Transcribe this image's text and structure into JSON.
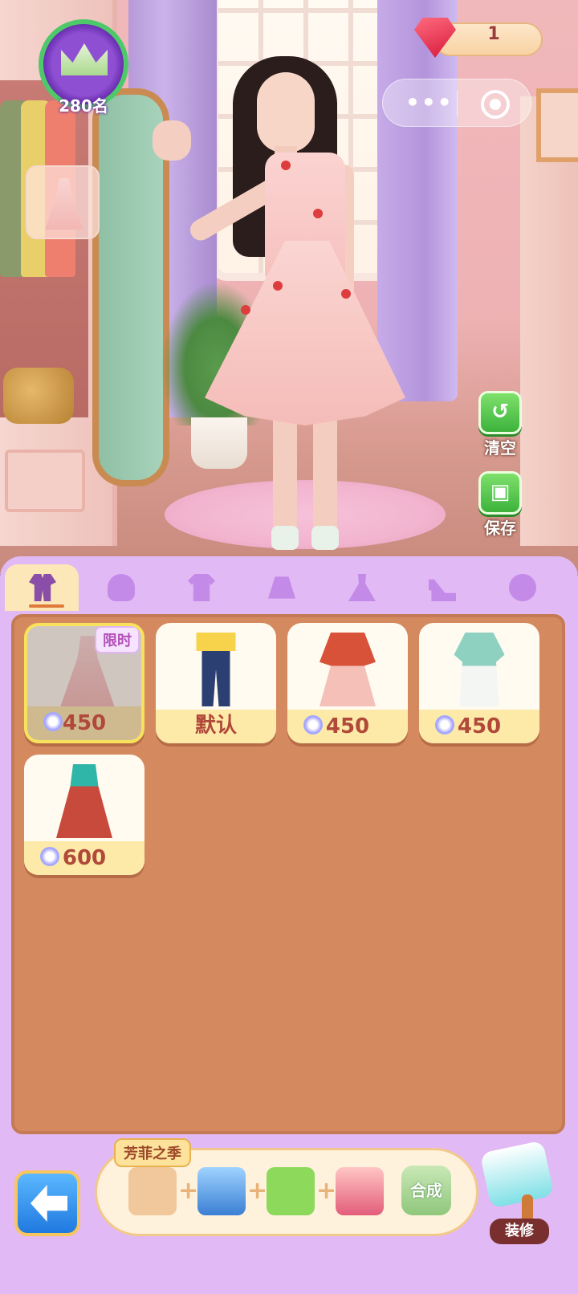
{
  "rank": {
    "label": "280名"
  },
  "currency": {
    "gems": "1"
  },
  "actions": {
    "clear": "清空",
    "save": "保存"
  },
  "tabs": [
    {
      "id": "outfit",
      "icon": "outfit-icon",
      "active": true
    },
    {
      "id": "hair",
      "icon": "hair-icon",
      "active": false
    },
    {
      "id": "top",
      "icon": "shirt-icon",
      "active": false
    },
    {
      "id": "skirt",
      "icon": "skirt-icon",
      "active": false
    },
    {
      "id": "dress",
      "icon": "dress-icon",
      "active": false
    },
    {
      "id": "shoes",
      "icon": "heel-icon",
      "active": false
    },
    {
      "id": "accessory",
      "icon": "accessory-icon",
      "active": false
    }
  ],
  "items": [
    {
      "name": "pink-floral-dress",
      "price": "450",
      "badge": "限时",
      "selected": true
    },
    {
      "name": "denim-overalls",
      "price": "默认",
      "selected": false
    },
    {
      "name": "red-jacket-pink-dress",
      "price": "450",
      "selected": false
    },
    {
      "name": "mint-qipao-set",
      "price": "450",
      "selected": false
    },
    {
      "name": "teal-red-ethnic-dress",
      "price": "600",
      "selected": false
    }
  ],
  "recipe": {
    "title": "芳菲之季",
    "items": [
      "lace-fabric-icon",
      "blue-fabric-icon",
      "green-check-fabric-icon",
      "sewing-machine-icon"
    ],
    "synth_label": "合成"
  },
  "decorate": {
    "label": "装修"
  },
  "colors": {
    "panel": "#e1b9f4",
    "grid": "#d4895f",
    "accent": "#f8e15c"
  }
}
